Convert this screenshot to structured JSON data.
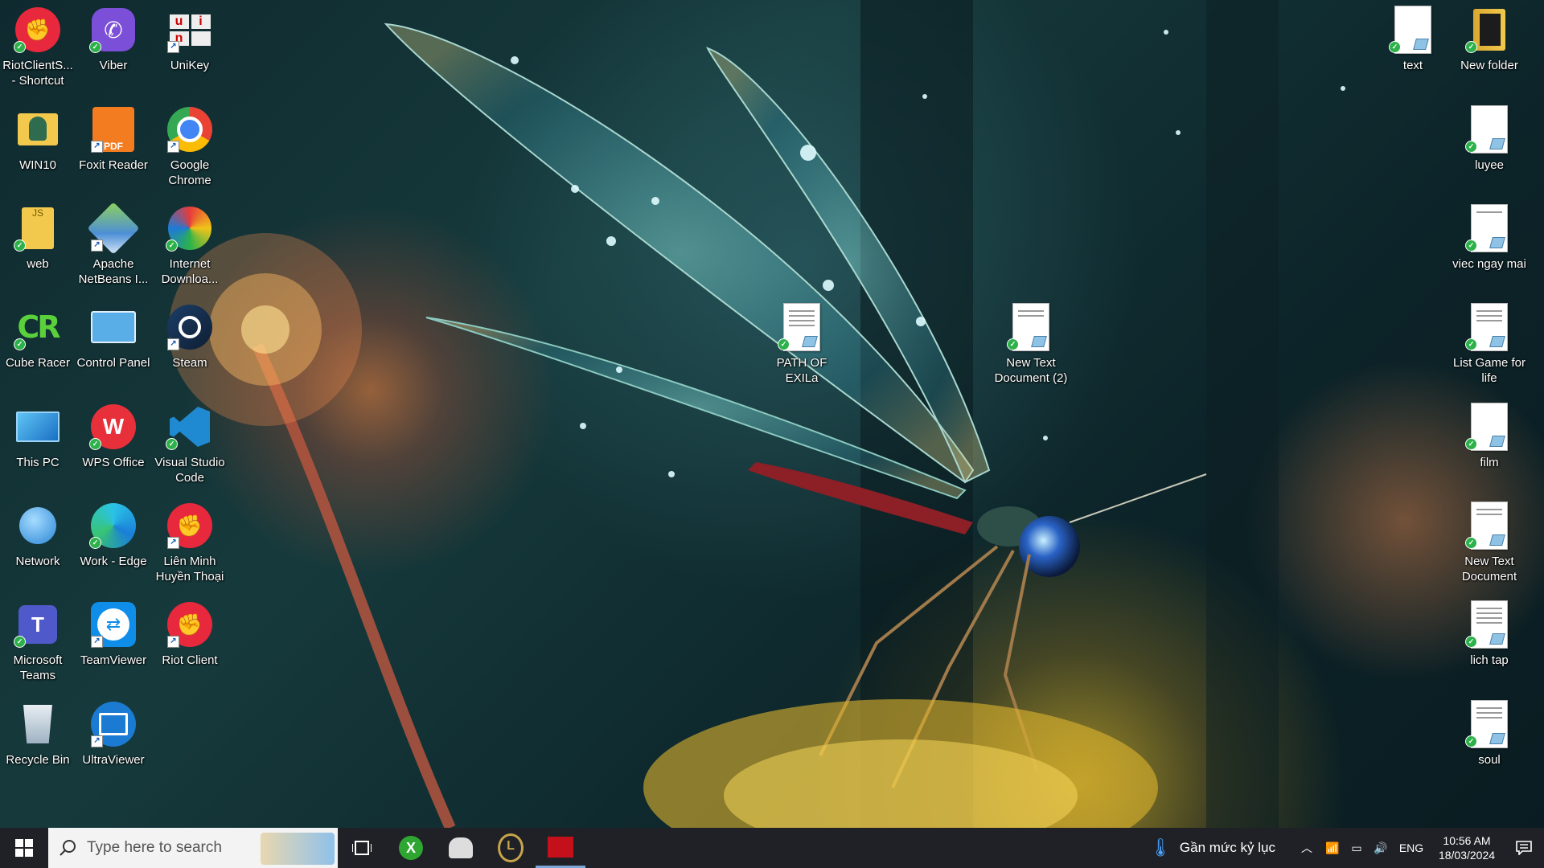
{
  "desktop": {
    "left_icons": [
      {
        "label": "RiotClientS... - Shortcut",
        "icon": "riot-client-icon",
        "badge": "sync"
      },
      {
        "label": "Viber",
        "icon": "viber-icon",
        "badge": "sync"
      },
      {
        "label": "UniKey",
        "icon": "unikey-icon",
        "badge": "shortcut"
      },
      {
        "label": "WIN10",
        "icon": "folder-user-icon",
        "badge": "none"
      },
      {
        "label": "Foxit Reader",
        "icon": "foxit-pdf-icon",
        "badge": "shortcut"
      },
      {
        "label": "Google Chrome",
        "icon": "chrome-icon",
        "badge": "shortcut"
      },
      {
        "label": "web",
        "icon": "folder-icon",
        "badge": "sync"
      },
      {
        "label": "Apache NetBeans I...",
        "icon": "netbeans-icon",
        "badge": "shortcut"
      },
      {
        "label": "Internet Downloa...",
        "icon": "idm-icon",
        "badge": "sync"
      },
      {
        "label": "Cube Racer",
        "icon": "cube-racer-icon",
        "badge": "sync"
      },
      {
        "label": "Control Panel",
        "icon": "control-panel-icon",
        "badge": "none"
      },
      {
        "label": "Steam",
        "icon": "steam-icon",
        "badge": "shortcut"
      },
      {
        "label": "This PC",
        "icon": "this-pc-icon",
        "badge": "none"
      },
      {
        "label": "WPS Office",
        "icon": "wps-office-icon",
        "badge": "sync"
      },
      {
        "label": "Visual Studio Code",
        "icon": "vscode-icon",
        "badge": "sync"
      },
      {
        "label": "Network",
        "icon": "network-icon",
        "badge": "none"
      },
      {
        "label": "Work - Edge",
        "icon": "edge-icon",
        "badge": "sync"
      },
      {
        "label": "Liên Minh Huyền Thoại",
        "icon": "riot-client-icon",
        "badge": "shortcut"
      },
      {
        "label": "Microsoft Teams",
        "icon": "teams-icon",
        "badge": "sync"
      },
      {
        "label": "TeamViewer",
        "icon": "teamviewer-icon",
        "badge": "shortcut"
      },
      {
        "label": "Riot Client",
        "icon": "riot-client-icon",
        "badge": "shortcut"
      },
      {
        "label": "Recycle Bin",
        "icon": "recycle-bin-icon",
        "badge": "none"
      },
      {
        "label": "UltraViewer",
        "icon": "ultraviewer-icon",
        "badge": "shortcut"
      }
    ],
    "middle_icons": [
      {
        "label": "PATH OF EXILa",
        "icon": "text-document-icon"
      },
      {
        "label": "New Text Document (2)",
        "icon": "text-document-icon"
      }
    ],
    "right_icons": [
      {
        "label": "text",
        "icon": "text-document-icon"
      },
      {
        "label": "New folder",
        "icon": "folder-icon"
      },
      {
        "label": "luyee",
        "icon": "text-document-icon"
      },
      {
        "label": "viec ngay mai",
        "icon": "text-document-icon"
      },
      {
        "label": "List Game for life",
        "icon": "text-document-icon"
      },
      {
        "label": "film",
        "icon": "text-document-icon"
      },
      {
        "label": "New Text Document",
        "icon": "text-document-icon"
      },
      {
        "label": "lich tap",
        "icon": "text-document-icon"
      },
      {
        "label": "soul",
        "icon": "text-document-icon"
      }
    ]
  },
  "taskbar": {
    "search_placeholder": "Type here to search",
    "pinned": [
      "task-view-icon",
      "xbox-icon",
      "spy-icon",
      "league-of-legends-icon",
      "game-red-icon"
    ],
    "weather_text": "Gần mức kỷ lục",
    "language": "ENG",
    "time": "10:56 AM",
    "date": "18/03/2024"
  },
  "colors": {
    "taskbar_bg": "#1f2126",
    "sync_check": "#2db14a",
    "riot_red": "#e8283c"
  }
}
